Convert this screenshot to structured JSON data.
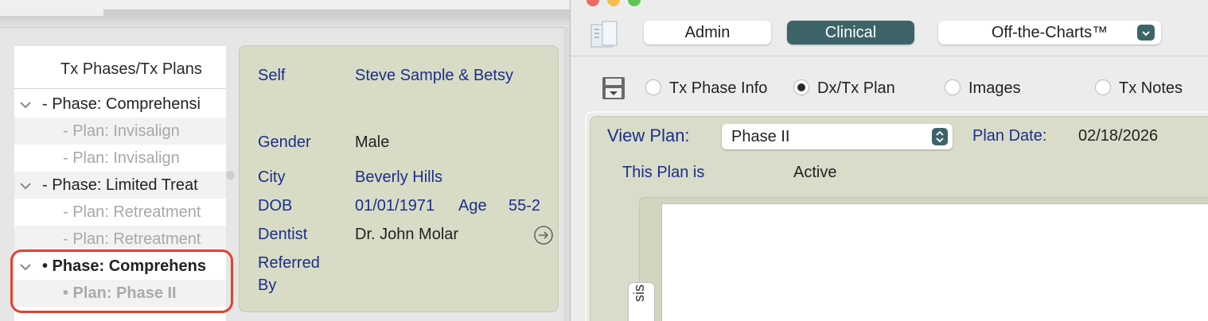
{
  "left_window": {
    "tree": {
      "header": "Tx Phases/Tx Plans",
      "rows": [
        {
          "kind": "phase",
          "label": "- Phase: Comprehensi"
        },
        {
          "kind": "plan",
          "label": "- Plan: Invisalign"
        },
        {
          "kind": "plan",
          "label": "- Plan: Invisalign"
        },
        {
          "kind": "phase",
          "label": "- Phase: Limited Treat"
        },
        {
          "kind": "plan",
          "label": "- Plan: Retreatment"
        },
        {
          "kind": "plan",
          "label": "- Plan: Retreatment"
        },
        {
          "kind": "phase",
          "label": "• Phase: Comprehens"
        },
        {
          "kind": "plan",
          "label": "• Plan: Phase II"
        }
      ]
    },
    "patient": {
      "self_label": "Self",
      "self_value": "Steve Sample & Betsy",
      "gender_label": "Gender",
      "gender_value": "Male",
      "city_label": "City",
      "city_value": "Beverly Hills",
      "dob_label": "DOB",
      "dob_value": "01/01/1971",
      "age_label": "Age",
      "age_value": "55-2",
      "dentist_label": "Dentist",
      "dentist_value": "Dr. John Molar",
      "referred_label_1": "Referred",
      "referred_label_2": "By"
    }
  },
  "right_window": {
    "toolbar": {
      "admin_label": "Admin",
      "clinical_label": "Clinical",
      "selector_value": "Off-the-Charts™"
    },
    "view_options": [
      {
        "label": "Tx Phase Info",
        "selected": false
      },
      {
        "label": "Dx/Tx Plan",
        "selected": true
      },
      {
        "label": "Images",
        "selected": false
      },
      {
        "label": "Tx Notes",
        "selected": false
      }
    ],
    "plan": {
      "view_plan_label": "View Plan:",
      "view_plan_value": "Phase II",
      "plan_date_label": "Plan Date:",
      "plan_date_value": "02/18/2026",
      "plan_status_label": "This Plan is",
      "plan_status_value": "Active",
      "side_tab_label": "sis"
    }
  },
  "colors": {
    "label_blue": "#1b2f8a",
    "accent_teal": "#3d6468",
    "highlight_red": "#e0432f",
    "panel_olive": "#d8dcc6"
  }
}
